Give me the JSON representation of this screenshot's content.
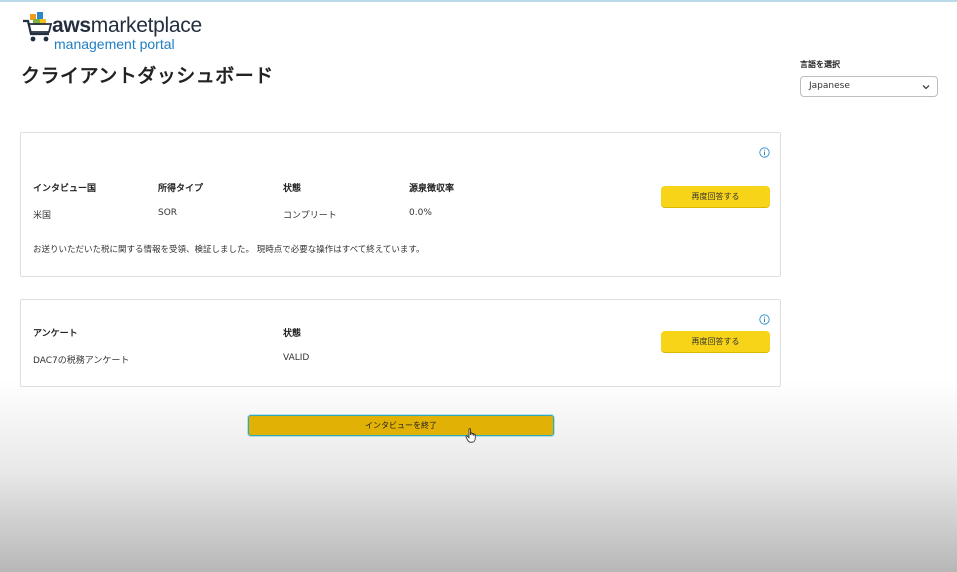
{
  "logo": {
    "brand_aws": "aws",
    "brand_rest": "marketplace",
    "subtitle": "management portal",
    "icon": "shopping-cart-logo"
  },
  "page": {
    "title": "クライアントダッシュボード"
  },
  "language": {
    "label": "言語を選択",
    "selected": "Japanese",
    "icon": "chevron-down-icon"
  },
  "interview_card": {
    "headers": [
      "インタビュー国",
      "所得タイプ",
      "状態",
      "源泉徴収率"
    ],
    "values": [
      "米国",
      "SOR",
      "コンプリート",
      "0.0%"
    ],
    "note": "お送りいただいた税に関する情報を受領、検証しました。 現時点で必要な操作はすべて終えています。",
    "button_label": "再度回答する",
    "icon": "info-icon"
  },
  "survey_card": {
    "headers": [
      "アンケート",
      "状態"
    ],
    "values": [
      "DAC7の税務アンケート",
      "VALID"
    ],
    "button_label": "再度回答する",
    "icon": "info-icon"
  },
  "finish_button_label": "インタビューを終了",
  "colors": {
    "accent_yellow": "#f7d417",
    "finish_yellow": "#e2b105",
    "logo_blue": "#1f7fc4",
    "logo_dark": "#232f3e"
  }
}
